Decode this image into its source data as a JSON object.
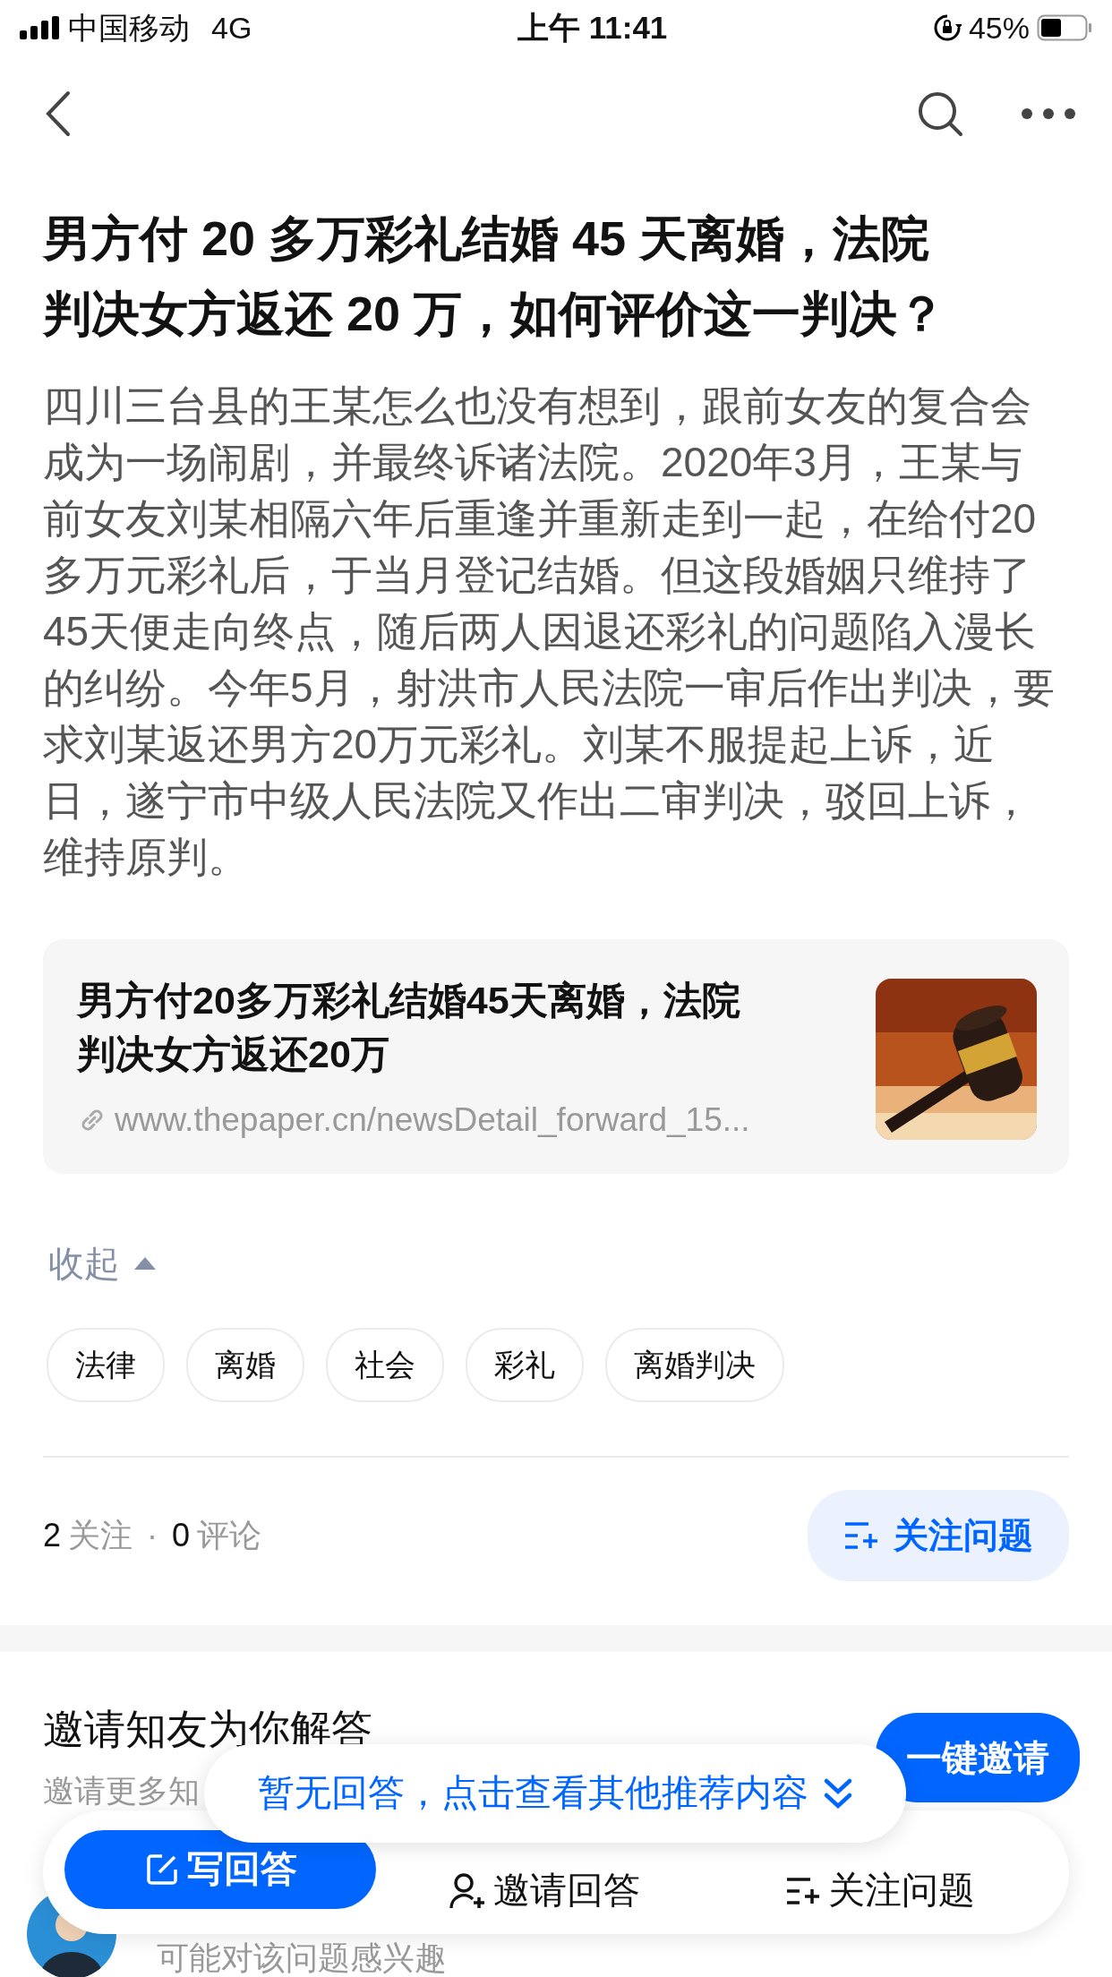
{
  "status_bar": {
    "carrier": "中国移动",
    "network": "4G",
    "time": "上午 11:41",
    "battery": "45%"
  },
  "question": {
    "title": "男方付 20 多万彩礼结婚 45 天离婚，法院判决女方返还 20 万，如何评价这一判决？",
    "detail": "四川三台县的王某怎么也没有想到，跟前女友的复合会成为一场闹剧，并最终诉诸法院。2020年3月，王某与前女友刘某相隔六年后重逢并重新走到一起，在给付20多万元彩礼后，于当月登记结婚。但这段婚姻只维持了45天便走向终点，随后两人因退还彩礼的问题陷入漫长的纠纷。今年5月，射洪市人民法院一审后作出判决，要求刘某返还男方20万元彩礼。刘某不服提起上诉，近日，遂宁市中级人民法院又作出二审判决，驳回上诉，维持原判。",
    "link_card": {
      "title": "男方付20多万彩礼结婚45天离婚，法院判决女方返还20万",
      "url": "www.thepaper.cn/newsDetail_forward_15..."
    },
    "collapse": "收起",
    "tags": [
      "法律",
      "离婚",
      "社会",
      "彩礼",
      "离婚判决"
    ],
    "stats_separator": "·",
    "stats": [
      {
        "count": "2",
        "label": "关注"
      },
      {
        "count": "0",
        "label": "评论"
      }
    ],
    "follow_button": "关注问题"
  },
  "invite": {
    "title": "邀请知友为你解答",
    "subtitle": "邀请更多知",
    "button": "一键邀请",
    "suggestion": "可能对该问题感兴趣"
  },
  "toast": "暂无回答，点击查看其他推荐内容",
  "bottom_bar": [
    {
      "kind": "write",
      "label": "写回答"
    },
    {
      "kind": "invite",
      "label": "邀请回答"
    },
    {
      "kind": "follow",
      "label": "关注问题"
    }
  ]
}
